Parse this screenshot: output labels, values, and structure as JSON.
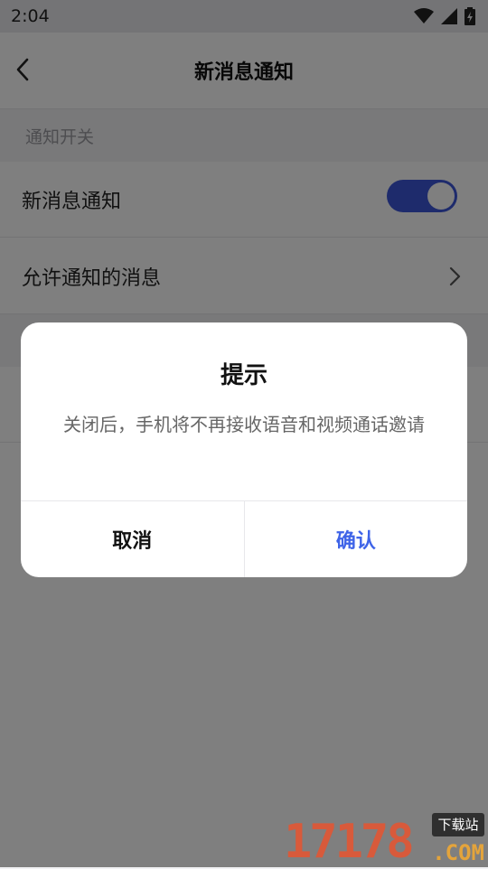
{
  "status_bar": {
    "time": "2:04"
  },
  "header": {
    "title": "新消息通知"
  },
  "settings": {
    "section_label": "通知开关",
    "rows": [
      {
        "label": "新消息通知",
        "toggle_on": true
      },
      {
        "label": "允许通知的消息"
      }
    ]
  },
  "dialog": {
    "title": "提示",
    "message": "关闭后，手机将不再接收语音和视频通话邀请",
    "cancel_label": "取消",
    "confirm_label": "确认"
  },
  "watermark": {
    "number": "17178",
    "badge": "下载站",
    "domain": ".COM"
  },
  "colors": {
    "accent": "#3d57d8",
    "confirm": "#3f64e8",
    "overlay": "rgba(0,0,0,0.5)"
  }
}
